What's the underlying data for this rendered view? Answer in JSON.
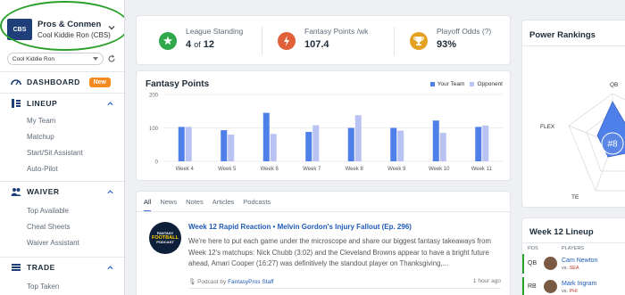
{
  "sidebar": {
    "team": {
      "logo_text": "CBS",
      "name": "Pros & Conmen",
      "subtitle": "Cool Kiddie Ron (CBS)"
    },
    "account_select": "Cool Kiddie Ron",
    "dashboard": {
      "label": "DASHBOARD",
      "badge": "New"
    },
    "lineup": {
      "label": "LINEUP",
      "items": [
        "My Team",
        "Matchup",
        "Start/Sit Assistant",
        "Auto-Pilot"
      ]
    },
    "waiver": {
      "label": "WAIVER",
      "items": [
        "Top Available",
        "Cheat Sheets",
        "Waiver Assistant"
      ]
    },
    "trade": {
      "label": "TRADE",
      "items": [
        "Top Taken"
      ]
    }
  },
  "stats": {
    "standing": {
      "label": "League Standing",
      "value": "4",
      "of": "of",
      "total": "12",
      "color": "#2ea84a"
    },
    "points": {
      "label": "Fantasy Points /wk",
      "value": "107.4",
      "color": "#e0603a"
    },
    "playoff": {
      "label": "Playoff Odds (?)",
      "value": "93%",
      "color": "#e3a021"
    }
  },
  "fantasy_points": {
    "title": "Fantasy Points",
    "legend": [
      "Your Team",
      "Opponent"
    ],
    "colors": {
      "team": "#4f7fe8",
      "opponent": "#b9c3f3"
    }
  },
  "chart_data": {
    "type": "bar",
    "title": "Fantasy Points",
    "categories": [
      "Week 4",
      "Week 5",
      "Week 6",
      "Week 7",
      "Week 8",
      "Week 9",
      "Week 10",
      "Week 11"
    ],
    "series": [
      {
        "name": "Your Team",
        "values": [
          103,
          93,
          145,
          88,
          100,
          100,
          122,
          103
        ]
      },
      {
        "name": "Opponent",
        "values": [
          103,
          80,
          82,
          108,
          138,
          92,
          85,
          107
        ]
      }
    ],
    "yticks": [
      0,
      100,
      200
    ],
    "ylim": [
      0,
      200
    ],
    "grid": true,
    "legend": "top-right"
  },
  "news": {
    "tabs": [
      "All",
      "News",
      "Notes",
      "Articles",
      "Podcasts"
    ],
    "logo_lines": [
      "FANTASY",
      "FOOTBALL",
      "PODCAST"
    ],
    "title": "Week 12 Rapid Reaction • Melvin Gordon's Injury Fallout (Ep. 296)",
    "body": "We're here to put each game under the microscope and share our biggest fantasy takeaways from Week 12's matchups: Nick Chubb (3:02) and the Cleveland Browns appear to have a bright future ahead, Amari Cooper (16:27) was definitively the standout player on Thanksgiving,...",
    "meta_prefix": "Podcast by",
    "meta_author": "FantasyPros Staff",
    "time": "1 hour ago"
  },
  "power_rankings": {
    "title": "Power Rankings",
    "axes": [
      "QB",
      "FLEX",
      "TE"
    ],
    "rank": "#8"
  },
  "lineup_card": {
    "title": "Week 12 Lineup",
    "head_pos": "POS",
    "head_players": "PLAYERS",
    "rows": [
      {
        "pos": "QB",
        "name": "Cam Newton",
        "vs": "vs.",
        "opp": "SEA"
      },
      {
        "pos": "RB",
        "name": "Mark Ingram",
        "vs": "vs.",
        "opp": "PHI"
      }
    ]
  }
}
